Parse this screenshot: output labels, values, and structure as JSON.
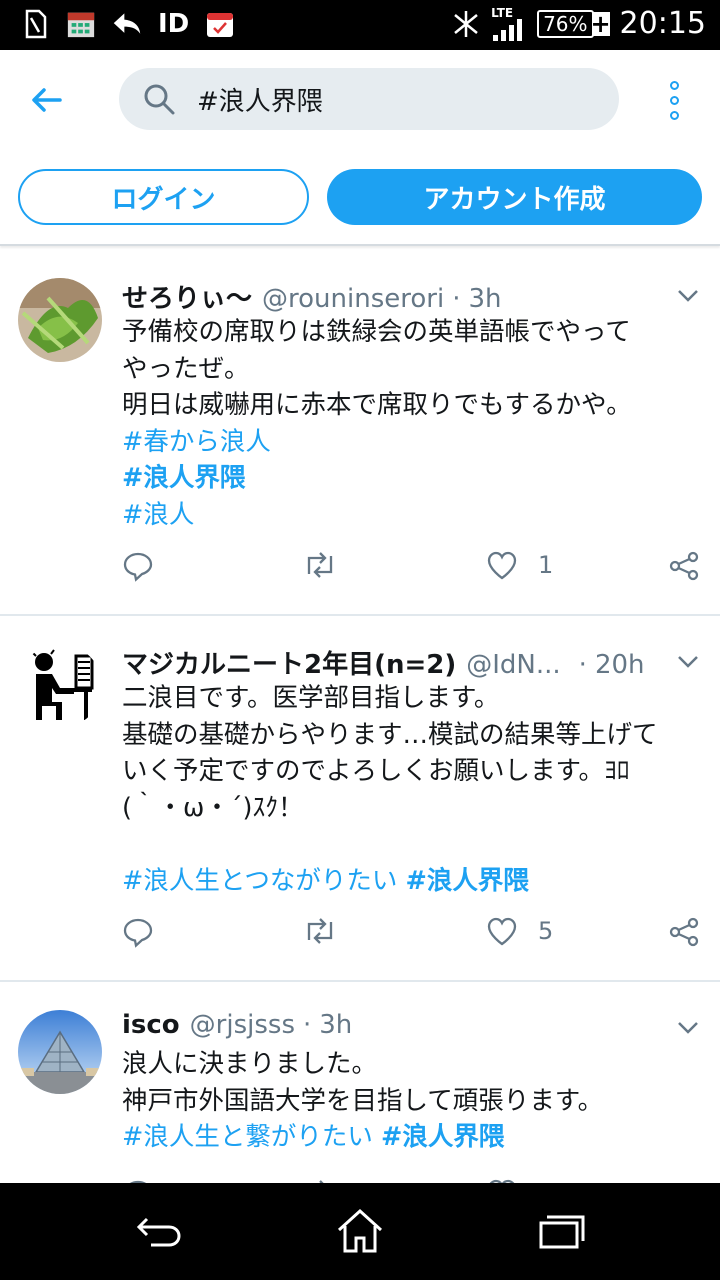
{
  "statusbar": {
    "id_label": "ID",
    "network": "LTE",
    "battery": "76%",
    "time": "20:15"
  },
  "search": {
    "query": "#浪人界隈"
  },
  "buttons": {
    "login": "ログイン",
    "signup": "アカウント作成"
  },
  "tweets": [
    {
      "name": "せろりぃ〜",
      "handle": "@rouninserori",
      "sep": "·",
      "time": "3h",
      "lines": [
        "予備校の席取りは鉄緑会の英単語帳でやって",
        "やったぜ。",
        "明日は威嚇用に赤本で席取りでもするかや。"
      ],
      "tags": [
        "#春から浪人",
        "#浪人界隈",
        "#浪人"
      ],
      "likes": "1"
    },
    {
      "name": "マジカルニート2年目(n=2)",
      "handle": "@IdN...",
      "sep": "·",
      "time": "20h",
      "lines": [
        "二浪目です。医学部目指します。",
        "基礎の基礎からやります…模試の結果等上げて",
        "いく予定ですのでよろしくお願いします。ﾖﾛ",
        "(｀・ω・´)ｽｸ！"
      ],
      "tags": [
        "#浪人生とつながりたい",
        "#浪人界隈"
      ],
      "likes": "5"
    },
    {
      "name": "isco",
      "handle": "@rjsjsss",
      "sep": "·",
      "time": "3h",
      "lines": [
        "浪人に決まりました。",
        "神戸市外国語大学を目指して頑張ります。"
      ],
      "tags": [
        "#浪人生と繋がりたい",
        "#浪人界隈"
      ]
    }
  ],
  "icons": {
    "back": "arrow-left-icon",
    "search": "search-icon",
    "more": "more-vertical-icon",
    "reply": "reply-icon",
    "retweet": "retweet-icon",
    "like": "heart-icon",
    "share": "share-icon",
    "caret": "chevron-down-icon",
    "nav_back": "nav-back-icon",
    "nav_home": "nav-home-icon",
    "nav_recent": "nav-recents-icon"
  },
  "colors": {
    "accent": "#1da1f2",
    "text": "#14171a",
    "muted": "#657786",
    "search_bg": "#e6ecf0"
  }
}
